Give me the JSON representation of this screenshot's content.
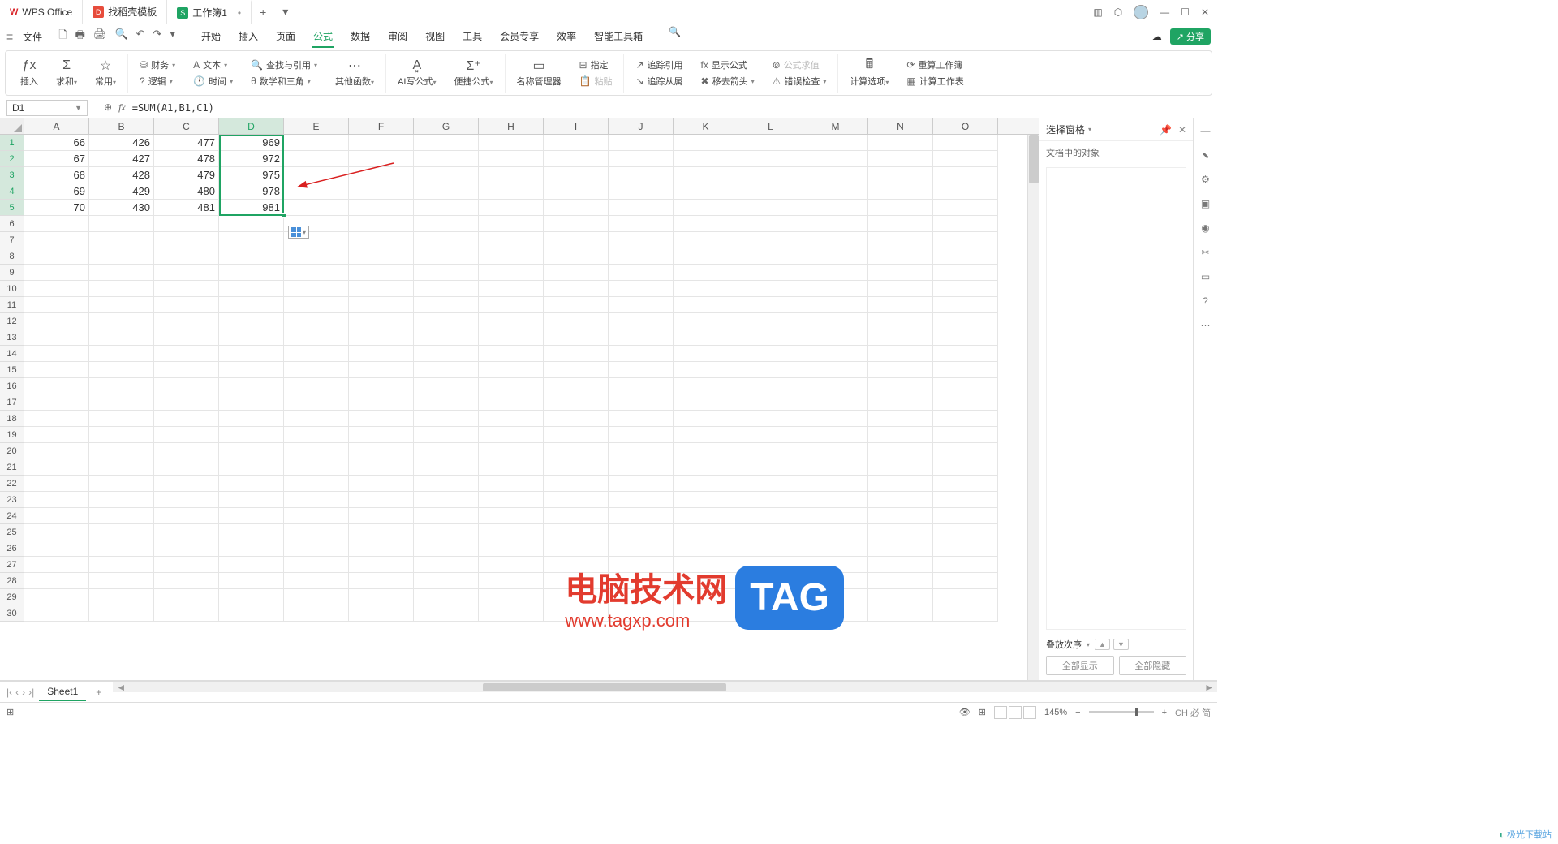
{
  "title_tabs": {
    "wps": "WPS Office",
    "templates": "找稻壳模板",
    "workbook": "工作簿1"
  },
  "file_menu": "文件",
  "menu_tabs": [
    "开始",
    "插入",
    "页面",
    "公式",
    "数据",
    "审阅",
    "视图",
    "工具",
    "会员专享",
    "效率",
    "智能工具箱"
  ],
  "active_menu_index": 3,
  "share_label": "分享",
  "ribbon": {
    "insert_fn": "插入",
    "sum": "求和",
    "common": "常用",
    "finance": "财务",
    "text": "文本",
    "lookup": "查找与引用",
    "math": "数学和三角",
    "logic": "逻辑",
    "datetime": "时间",
    "other_fn": "其他函数",
    "ai_formula": "AI写公式",
    "quick_formula": "便捷公式",
    "name_manager": "名称管理器",
    "paste": "粘贴",
    "specify": "指定",
    "trace_ref": "追踪引用",
    "show_formula": "显示公式",
    "formula_eval": "公式求值",
    "trace_dep": "追踪从属",
    "remove_arrow": "移去箭头",
    "error_check": "错误检查",
    "calc_options": "计算选项",
    "recalc_book": "重算工作簿",
    "calc_sheet": "计算工作表"
  },
  "name_box": "D1",
  "formula": "=SUM(A1,B1,C1)",
  "columns": [
    "A",
    "B",
    "C",
    "D",
    "E",
    "F",
    "G",
    "H",
    "I",
    "J",
    "K",
    "L",
    "M",
    "N",
    "O"
  ],
  "selected_col": "D",
  "row_count": 30,
  "selected_rows": [
    1,
    2,
    3,
    4,
    5
  ],
  "cells": {
    "r1": {
      "A": "66",
      "B": "426",
      "C": "477",
      "D": "969"
    },
    "r2": {
      "A": "67",
      "B": "427",
      "C": "478",
      "D": "972"
    },
    "r3": {
      "A": "68",
      "B": "428",
      "C": "479",
      "D": "975"
    },
    "r4": {
      "A": "69",
      "B": "429",
      "C": "480",
      "D": "978"
    },
    "r5": {
      "A": "70",
      "B": "430",
      "C": "481",
      "D": "981"
    }
  },
  "right_panel": {
    "title": "选择窗格",
    "subtitle": "文档中的对象",
    "stack_label": "叠放次序",
    "show_all": "全部显示",
    "hide_all": "全部隐藏"
  },
  "sheet_tab": "Sheet1",
  "zoom": "145%",
  "ime_status": "CH 必 简",
  "watermark": {
    "text1": "电脑技术网",
    "text2": "www.tagxp.com",
    "tag": "TAG",
    "brand": "极光下载站"
  }
}
